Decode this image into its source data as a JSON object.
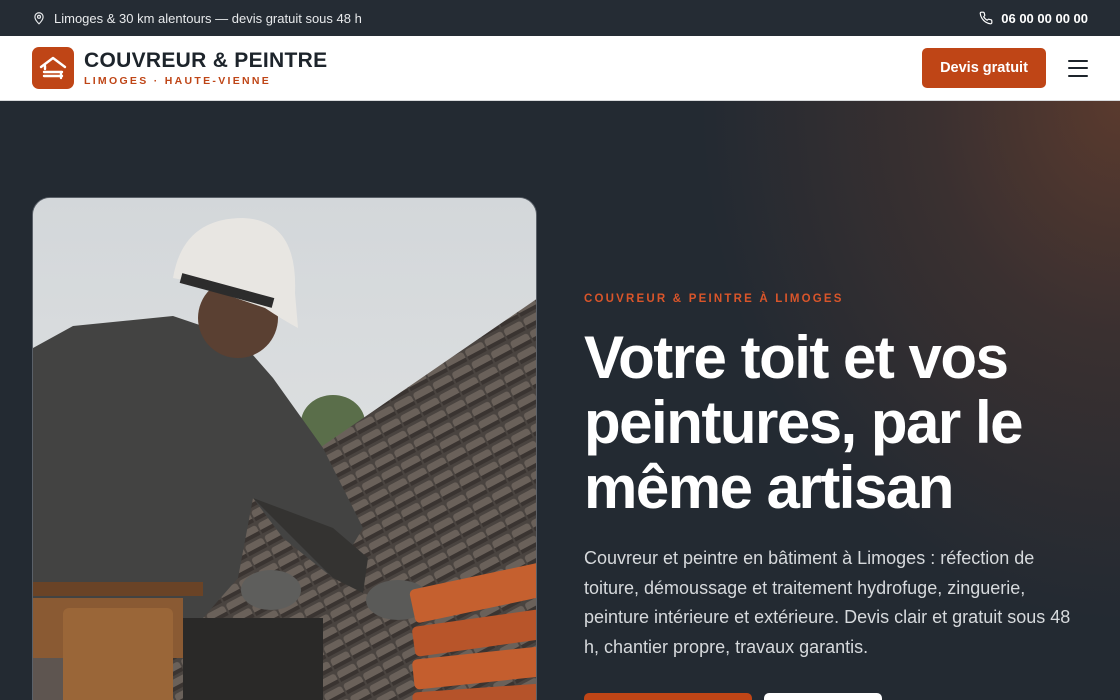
{
  "topbar": {
    "location_icon": "map-pin-icon",
    "location_text": "Limoges & 30 km alentours — devis gratuit sous 48 h",
    "phone_icon": "phone-icon",
    "phone": "06 00 00 00 00"
  },
  "header": {
    "logo_icon": "house-roof-icon",
    "brand_name": "COUVREUR & PEINTRE",
    "brand_sub": "LIMOGES · HAUTE-VIENNE",
    "cta_label": "Devis gratuit",
    "menu_icon": "hamburger-menu-icon"
  },
  "hero": {
    "image": "roofer-on-tiled-roof-photo",
    "eyebrow": "COUVREUR & PEINTRE À LIMOGES",
    "title": "Votre toit et vos peintures, par le même artisan",
    "description": "Couvreur et peintre en bâtiment à Limoges : réfection de toiture, démoussage et traitement hydrofuge, zinguerie, peinture intérieure et extérieure. Devis clair et gratuit sous 48 h, chantier propre, travaux garantis."
  },
  "colors": {
    "accent": "#bf4516",
    "dark": "#232a32",
    "eyebrow": "#d9552a",
    "white": "#ffffff"
  }
}
